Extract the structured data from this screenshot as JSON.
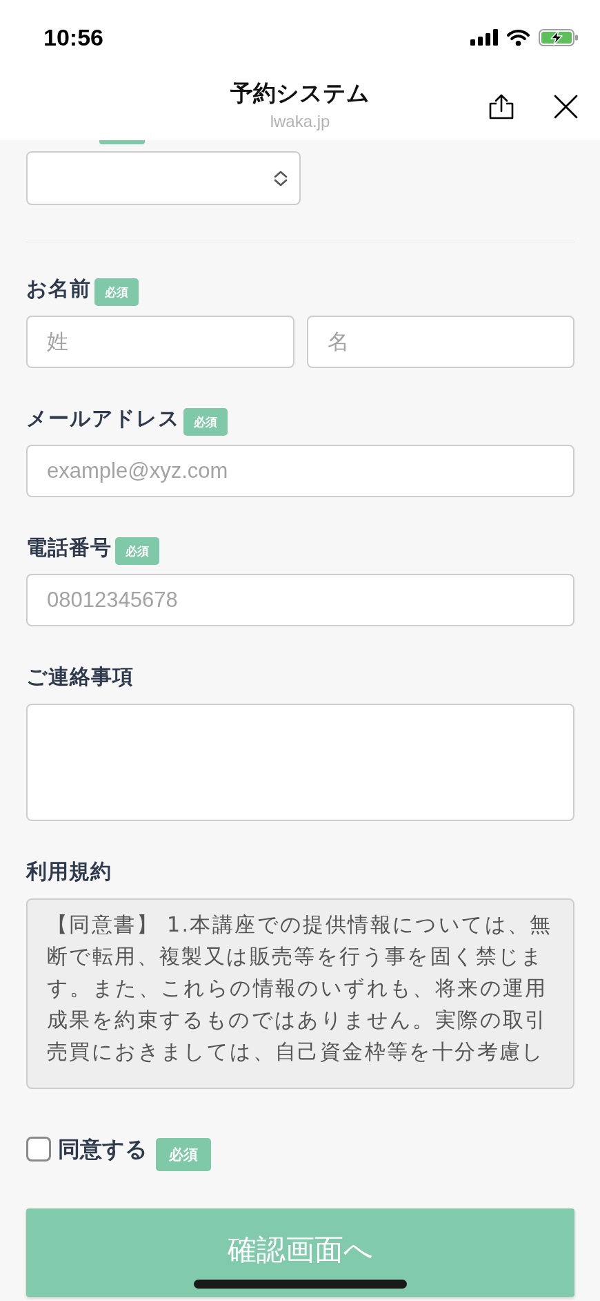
{
  "status_bar": {
    "time": "10:56"
  },
  "header": {
    "title": "予約システム",
    "domain": "lwaka.jp"
  },
  "fields": [
    {
      "kind": "select",
      "required": true
    },
    {
      "kind": "name",
      "label": "お名前",
      "badge": "必須",
      "inputs": [
        {
          "placeholder": "姓"
        },
        {
          "placeholder": "名"
        }
      ]
    },
    {
      "kind": "text",
      "label": "メールアドレス",
      "badge": "必須",
      "placeholder": "example@xyz.com"
    },
    {
      "kind": "text",
      "label": "電話番号",
      "badge": "必須",
      "placeholder": "08012345678"
    },
    {
      "kind": "textarea",
      "label": "ご連絡事項"
    },
    {
      "kind": "terms",
      "label": "利用規約",
      "text": "【同意書】 1.本講座での提供情報については、無断で転用、複製又は販売等を行う事を固く禁じます。また、これらの情報のいずれも、将来の運用成果を約束するものではありません。実際の取引売買におきましては、自己資金枠等を十分考慮し"
    }
  ],
  "consent": {
    "label": "同意する",
    "badge": "必須",
    "checked": false
  },
  "submit": {
    "label": "確認画面へ"
  }
}
